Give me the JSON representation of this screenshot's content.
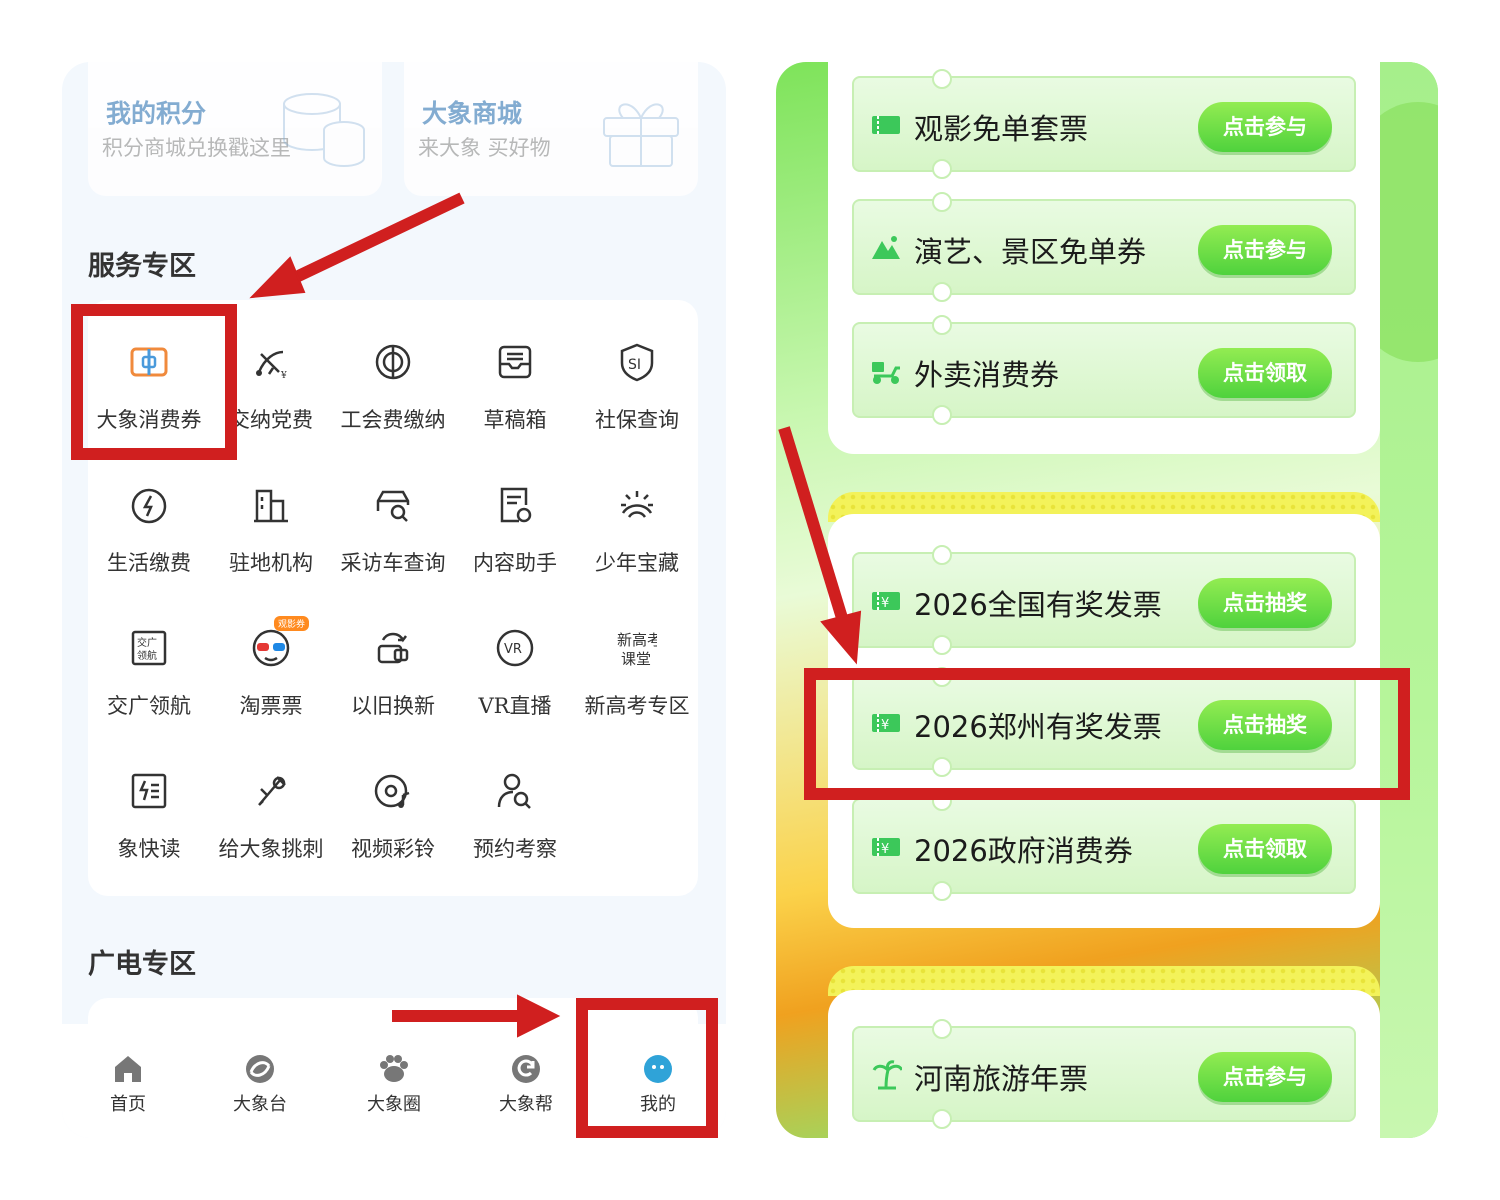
{
  "left": {
    "top_cards": [
      {
        "title": "我的积分",
        "subtitle": "积分商城兑换戳这里",
        "icon": "coins-icon"
      },
      {
        "title": "大象商城",
        "subtitle": "来大象 买好物",
        "icon": "gift-box-icon"
      }
    ],
    "service_section_title": "服务专区",
    "services": [
      {
        "label": "大象消费券",
        "icon": "coupon-icon"
      },
      {
        "label": "交纳党费",
        "icon": "party-emblem-icon"
      },
      {
        "label": "工会费缴纳",
        "icon": "union-dues-icon"
      },
      {
        "label": "草稿箱",
        "icon": "drafts-tray-icon"
      },
      {
        "label": "社保查询",
        "icon": "social-security-icon"
      },
      {
        "label": "生活缴费",
        "icon": "utility-bolt-icon"
      },
      {
        "label": "驻地机构",
        "icon": "building-icon"
      },
      {
        "label": "采访车查询",
        "icon": "car-search-icon"
      },
      {
        "label": "内容助手",
        "icon": "document-refresh-icon"
      },
      {
        "label": "少年宝藏",
        "icon": "sun-treasure-icon"
      },
      {
        "label": "交广领航",
        "icon": "traffic-radio-icon"
      },
      {
        "label": "淘票票",
        "icon": "3d-glasses-icon",
        "badge": "观影券"
      },
      {
        "label": "以旧换新",
        "icon": "trade-in-icon"
      },
      {
        "label": "VR直播",
        "icon": "vr-icon"
      },
      {
        "label": "新高考专区",
        "icon": "new-gaokao-icon"
      },
      {
        "label": "象快读",
        "icon": "quick-read-icon"
      },
      {
        "label": "给大象挑刺",
        "icon": "feedback-tool-icon"
      },
      {
        "label": "视频彩铃",
        "icon": "video-ringtone-icon"
      },
      {
        "label": "预约考察",
        "icon": "user-search-icon"
      }
    ],
    "broadcast_section_title": "广电专区",
    "tabs": [
      {
        "label": "首页",
        "icon": "home-icon"
      },
      {
        "label": "大象台",
        "icon": "swirl-icon"
      },
      {
        "label": "大象圈",
        "icon": "paw-icon"
      },
      {
        "label": "大象帮",
        "icon": "refresh-circle-icon"
      },
      {
        "label": "我的",
        "icon": "profile-face-icon"
      }
    ]
  },
  "right": {
    "tickets": [
      {
        "label": "观影免单套票",
        "button": "点击参与",
        "icon": "ticket-strip-icon"
      },
      {
        "label": "演艺、景区免单券",
        "button": "点击参与",
        "icon": "mountain-icon"
      },
      {
        "label": "外卖消费券",
        "button": "点击领取",
        "icon": "delivery-scooter-icon"
      },
      {
        "label": "2026全国有奖发票",
        "button": "点击抽奖",
        "icon": "invoice-yen-icon"
      },
      {
        "label": "2026郑州有奖发票",
        "button": "点击抽奖",
        "icon": "invoice-yen-icon"
      },
      {
        "label": "2026政府消费券",
        "button": "点击领取",
        "icon": "invoice-yen-icon"
      },
      {
        "label": "河南旅游年票",
        "button": "点击参与",
        "icon": "palm-tree-icon"
      }
    ]
  },
  "colors": {
    "highlight_red": "#d01f1f",
    "button_green": "#4fd23d",
    "title_blue": "#3f7fb7"
  }
}
